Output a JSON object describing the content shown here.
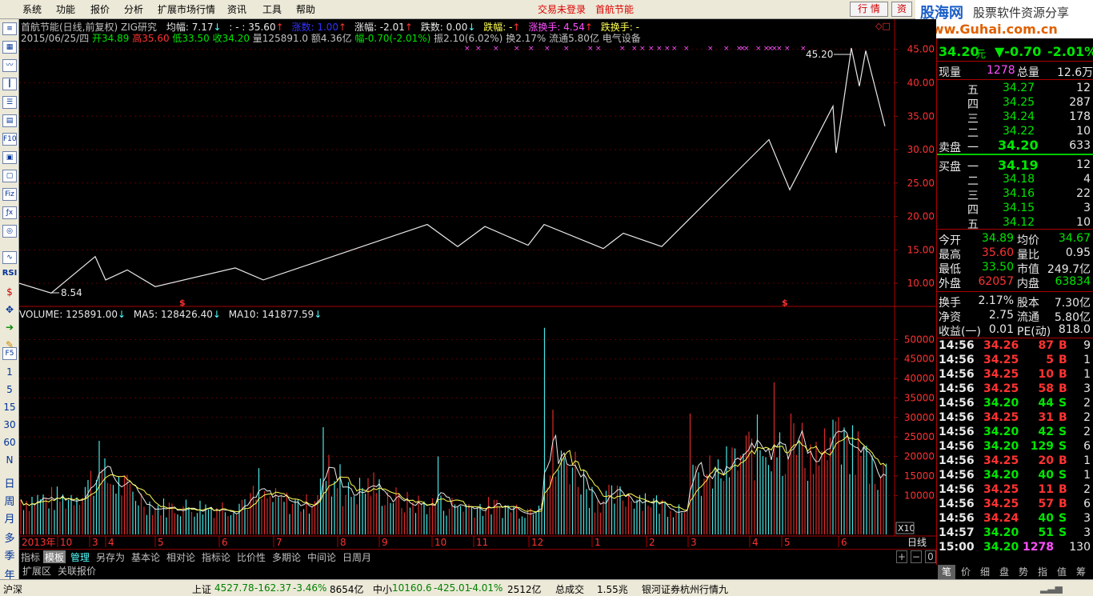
{
  "menu": {
    "items": [
      "系统",
      "功能",
      "报价",
      "分析",
      "扩展市场行情",
      "资讯",
      "工具",
      "帮助"
    ],
    "trade_status": "交易未登录",
    "stock_name": "首航节能",
    "btn_quote": "行 情",
    "btn_info": "资"
  },
  "logo": {
    "line1": "股海网",
    "line2": "股票软件资源分享",
    "line3": "www.Guhai.com.cn"
  },
  "left_toolbar": {
    "icons": [
      "report-icon",
      "split-icon",
      "line-chart-icon",
      "candle-icon",
      "list-icon",
      "grid-icon",
      "f10-icon",
      "doc-icon",
      "news-icon",
      "fiz-icon",
      "formula-icon",
      "zoom-icon",
      "indicator-icon"
    ],
    "rsi": "RSI",
    "periods": [
      "1",
      "5",
      "15",
      "30",
      "60",
      "N",
      "日",
      "周",
      "月",
      "多",
      "季",
      "年"
    ]
  },
  "chart": {
    "title": "首航节能(日线,前复权) ZIG研究",
    "avg_label": "均幅: 7.17",
    "colon_label": ": - : 35.60",
    "rise_label": "涨数: 1.00",
    "rise_pct_label": "涨幅: -2.01",
    "fall_label": "跌数: 0.00",
    "fall_pct_label": "跌幅: -",
    "rise_turn_label": "涨换手: 4.54",
    "fall_turn_label": "跌换手: -",
    "ohlc": {
      "date": "2015/06/25/四",
      "open": "开34.89",
      "high": "高35.60",
      "low": "低33.50",
      "close": "收34.20",
      "vol": "量125891.0",
      "amt": "额4.36亿",
      "chg": "幅-0.70(-2.01%)",
      "amp": "振2.10(6.02%)",
      "turn": "换2.17%",
      "float": "流通5.80亿",
      "sector": "电气设备"
    },
    "max_label": "45.20",
    "min_label": "8.54",
    "vol_label": "VOLUME: 125891.00",
    "ma5_label": "MA5: 128426.40",
    "ma10_label": "MA10: 141877.59",
    "x10": "X10",
    "period": "日线",
    "months": [
      "2013年",
      "10",
      "3",
      "4",
      "5",
      "6",
      "7",
      "8",
      "9",
      "10",
      "11",
      "12",
      "1",
      "2",
      "3",
      "4",
      "5",
      "6"
    ]
  },
  "chart_data": [
    {
      "type": "line",
      "title": "ZIG研究",
      "xlabel": "",
      "ylabel": "",
      "ylim": [
        7.5,
        47
      ],
      "yticks": [
        10,
        15,
        20,
        25,
        30,
        35,
        40,
        45
      ],
      "series": [
        {
          "name": "ZIG",
          "x": [
            0,
            40,
            95,
            108,
            135,
            170,
            270,
            305,
            510,
            548,
            582,
            636,
            656,
            730,
            755,
            803,
            937,
            963,
            1017,
            1021,
            1040,
            1050,
            1058,
            1082
          ],
          "values": [
            10.0,
            8.54,
            14.0,
            10.5,
            12.0,
            9.5,
            12.3,
            10.5,
            18.8,
            15.5,
            18.5,
            15.7,
            18.8,
            15.2,
            17.5,
            15.5,
            31.5,
            24.0,
            36.5,
            29.5,
            45.2,
            39.5,
            44.8,
            33.5
          ]
        }
      ]
    },
    {
      "type": "bar",
      "title": "VOLUME",
      "ylim": [
        0,
        55000
      ],
      "yticks": [
        10000,
        15000,
        20000,
        25000,
        30000,
        35000,
        40000,
        45000,
        50000
      ],
      "series": [
        {
          "name": "VOLUME",
          "last": 125891.0
        },
        {
          "name": "MA5",
          "last": 128426.4
        },
        {
          "name": "MA10",
          "last": 141877.59
        }
      ],
      "spikes": [
        [
          95,
          40000
        ],
        [
          100,
          24000
        ],
        [
          300,
          17000
        ],
        [
          381,
          27500
        ],
        [
          402,
          18000
        ],
        [
          525,
          20000
        ],
        [
          658,
          53000
        ],
        [
          667,
          32000
        ],
        [
          840,
          31000
        ],
        [
          943,
          39000
        ],
        [
          966,
          31000
        ],
        [
          1022,
          29000
        ],
        [
          1080,
          18000
        ]
      ]
    }
  ],
  "quote": {
    "price": "34.20",
    "unit": "元",
    "change": "▼-0.70",
    "pct": "-2.01%",
    "now_vol_label": "现量",
    "now_vol": "1278",
    "total_vol_label": "总量",
    "total_vol": "12.6万",
    "sell_label": "卖盘",
    "buy_label": "买盘",
    "sells": [
      {
        "level": "五",
        "price": "34.27",
        "vol": "12"
      },
      {
        "level": "四",
        "price": "34.25",
        "vol": "287"
      },
      {
        "level": "三",
        "price": "34.24",
        "vol": "178"
      },
      {
        "level": "二",
        "price": "34.22",
        "vol": "10"
      },
      {
        "level": "一",
        "price": "34.20",
        "vol": "633"
      }
    ],
    "buys": [
      {
        "level": "一",
        "price": "34.19",
        "vol": "12"
      },
      {
        "level": "二",
        "price": "34.18",
        "vol": "4"
      },
      {
        "level": "三",
        "price": "34.16",
        "vol": "22"
      },
      {
        "level": "四",
        "price": "34.15",
        "vol": "3"
      },
      {
        "level": "五",
        "price": "34.12",
        "vol": "10"
      }
    ],
    "stats": [
      {
        "l1": "今开",
        "v1": "34.89",
        "l2": "均价",
        "v2": "34.67"
      },
      {
        "l1": "最高",
        "v1": "35.60",
        "l2": "量比",
        "v2": "0.95"
      },
      {
        "l1": "最低",
        "v1": "33.50",
        "l2": "市值",
        "v2": "249.7亿"
      },
      {
        "l1": "外盘",
        "v1": "62057",
        "l2": "内盘",
        "v2": "63834"
      }
    ],
    "stats2": [
      {
        "l1": "换手",
        "v1": "2.17%",
        "l2": "股本",
        "v2": "7.30亿"
      },
      {
        "l1": "净资",
        "v1": "2.75",
        "l2": "流通",
        "v2": "5.80亿"
      },
      {
        "l1": "收益(一)",
        "v1": "0.01",
        "l2": "PE(动)",
        "v2": "818.0"
      }
    ],
    "ticks": [
      {
        "t": "14:56",
        "p": "34.26",
        "v": "87",
        "s": "B",
        "n": "9"
      },
      {
        "t": "14:56",
        "p": "34.25",
        "v": "5",
        "s": "B",
        "n": "1"
      },
      {
        "t": "14:56",
        "p": "34.25",
        "v": "10",
        "s": "B",
        "n": "1"
      },
      {
        "t": "14:56",
        "p": "34.25",
        "v": "58",
        "s": "B",
        "n": "3"
      },
      {
        "t": "14:56",
        "p": "34.20",
        "v": "44",
        "s": "S",
        "n": "2"
      },
      {
        "t": "14:56",
        "p": "34.25",
        "v": "31",
        "s": "B",
        "n": "2"
      },
      {
        "t": "14:56",
        "p": "34.20",
        "v": "42",
        "s": "S",
        "n": "2"
      },
      {
        "t": "14:56",
        "p": "34.20",
        "v": "129",
        "s": "S",
        "n": "6"
      },
      {
        "t": "14:56",
        "p": "34.25",
        "v": "20",
        "s": "B",
        "n": "1"
      },
      {
        "t": "14:56",
        "p": "34.20",
        "v": "40",
        "s": "S",
        "n": "1"
      },
      {
        "t": "14:56",
        "p": "34.25",
        "v": "11",
        "s": "B",
        "n": "2"
      },
      {
        "t": "14:56",
        "p": "34.25",
        "v": "57",
        "s": "B",
        "n": "6"
      },
      {
        "t": "14:56",
        "p": "34.24",
        "v": "40",
        "s": "S",
        "n": "3"
      },
      {
        "t": "14:57",
        "p": "34.20",
        "v": "51",
        "s": "S",
        "n": "3"
      },
      {
        "t": "15:00",
        "p": "34.20",
        "v": "1278",
        "s": "",
        "n": "130"
      }
    ]
  },
  "tabs": [
    "指标",
    "模板",
    "管理",
    "另存为",
    "基本论",
    "相对论",
    "指标论",
    "比价性",
    "多期论",
    "中间论",
    "日周月"
  ],
  "ext_tabs": [
    "扩展区",
    "关联报价"
  ],
  "right_btns": [
    "笔",
    "价",
    "细",
    "盘",
    "势",
    "指",
    "值",
    "筹"
  ],
  "status": {
    "market": "沪深",
    "sh_label": "上证",
    "sh_val": "4527.78",
    "sh_chg": "-162.37",
    "sh_pct": "-3.46%",
    "sh_amt": "8654亿",
    "zx_label": "中小",
    "zx_val": "10160.6",
    "zx_chg": "-425.01",
    "zx_pct": "-4.01%",
    "zx_amt": "2512亿",
    "total_label": "总成交",
    "total_val": "1.55兆",
    "broker": "银河证券杭州行情九"
  }
}
